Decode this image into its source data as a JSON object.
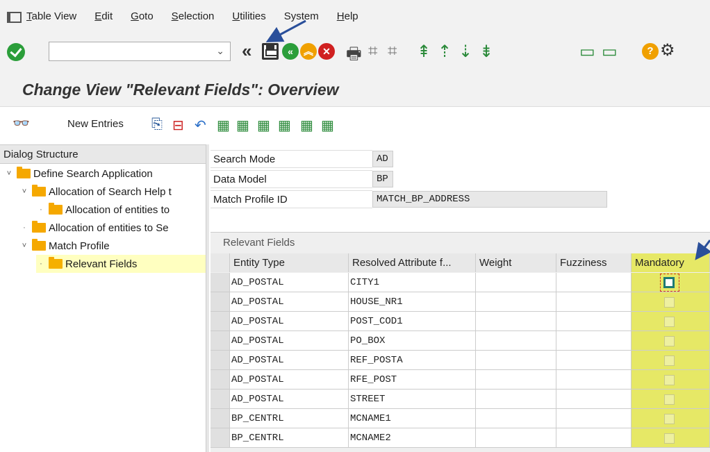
{
  "menu": {
    "items": [
      {
        "label": "Table View",
        "u": "T",
        "rest": "able View"
      },
      {
        "label": "Edit",
        "u": "E",
        "rest": "dit"
      },
      {
        "label": "Goto",
        "u": "G",
        "rest": "oto"
      },
      {
        "label": "Selection",
        "u": "S",
        "rest": "election"
      },
      {
        "label": "Utilities",
        "u": "U",
        "rest": "tilities"
      },
      {
        "label": "System",
        "u": "",
        "rest": "System"
      },
      {
        "label": "Help",
        "u": "H",
        "rest": "elp"
      }
    ]
  },
  "toolbar": {
    "command_value": "",
    "icons": [
      "check-icon",
      "command-field",
      "back-double-icon",
      "save-icon",
      "back-icon",
      "exit-icon",
      "cancel-icon",
      "print-icon",
      "find-icon",
      "find-next-icon",
      "first-page-icon",
      "previous-page-icon",
      "next-page-icon",
      "last-page-icon",
      "create-session-icon",
      "shortcut-icon",
      "help-icon",
      "settings-gear-icon"
    ]
  },
  "title": "Change View \"Relevant Fields\": Overview",
  "app_toolbar": {
    "new_entries": "New Entries"
  },
  "dialog_structure": {
    "header": "Dialog Structure",
    "items": [
      {
        "label": "Define Search Application",
        "level": 0,
        "toggle": "˅"
      },
      {
        "label": "Allocation of Search Help t",
        "level": 1,
        "toggle": "˅"
      },
      {
        "label": "Allocation of entities to",
        "level": 2,
        "toggle": "·"
      },
      {
        "label": "Allocation of entities to Se",
        "level": 1,
        "toggle": "·"
      },
      {
        "label": "Match Profile",
        "level": 1,
        "toggle": "˅"
      },
      {
        "label": "Relevant Fields",
        "level": 2,
        "toggle": "·",
        "selected": true
      }
    ]
  },
  "header_fields": [
    {
      "label": "Search Mode",
      "value": "AD"
    },
    {
      "label": "Data Model",
      "value": "BP"
    },
    {
      "label": "Match Profile ID",
      "value": "MATCH_BP_ADDRESS"
    }
  ],
  "table": {
    "caption": "Relevant Fields",
    "columns": [
      "Entity Type",
      "Resolved Attribute f...",
      "Weight",
      "Fuzziness",
      "Mandatory"
    ],
    "rows": [
      {
        "entity": "AD_POSTAL",
        "attr": "CITY1",
        "weight": "",
        "fuzziness": "",
        "mandatory": false,
        "focused": true
      },
      {
        "entity": "AD_POSTAL",
        "attr": "HOUSE_NR1",
        "weight": "",
        "fuzziness": "",
        "mandatory": false
      },
      {
        "entity": "AD_POSTAL",
        "attr": "POST_COD1",
        "weight": "",
        "fuzziness": "",
        "mandatory": false
      },
      {
        "entity": "AD_POSTAL",
        "attr": "PO_BOX",
        "weight": "",
        "fuzziness": "",
        "mandatory": false
      },
      {
        "entity": "AD_POSTAL",
        "attr": "REF_POSTA",
        "weight": "",
        "fuzziness": "",
        "mandatory": false
      },
      {
        "entity": "AD_POSTAL",
        "attr": "RFE_POST",
        "weight": "",
        "fuzziness": "",
        "mandatory": false
      },
      {
        "entity": "AD_POSTAL",
        "attr": "STREET",
        "weight": "",
        "fuzziness": "",
        "mandatory": false
      },
      {
        "entity": "BP_CENTRL",
        "attr": "MCNAME1",
        "weight": "",
        "fuzziness": "",
        "mandatory": false
      },
      {
        "entity": "BP_CENTRL",
        "attr": "MCNAME2",
        "weight": "",
        "fuzziness": "",
        "mandatory": false
      }
    ]
  },
  "colors": {
    "highlight_yellow": "#e6e866",
    "selection_yellow": "#ffffc0",
    "annotation_arrow": "#2a4f9a"
  }
}
